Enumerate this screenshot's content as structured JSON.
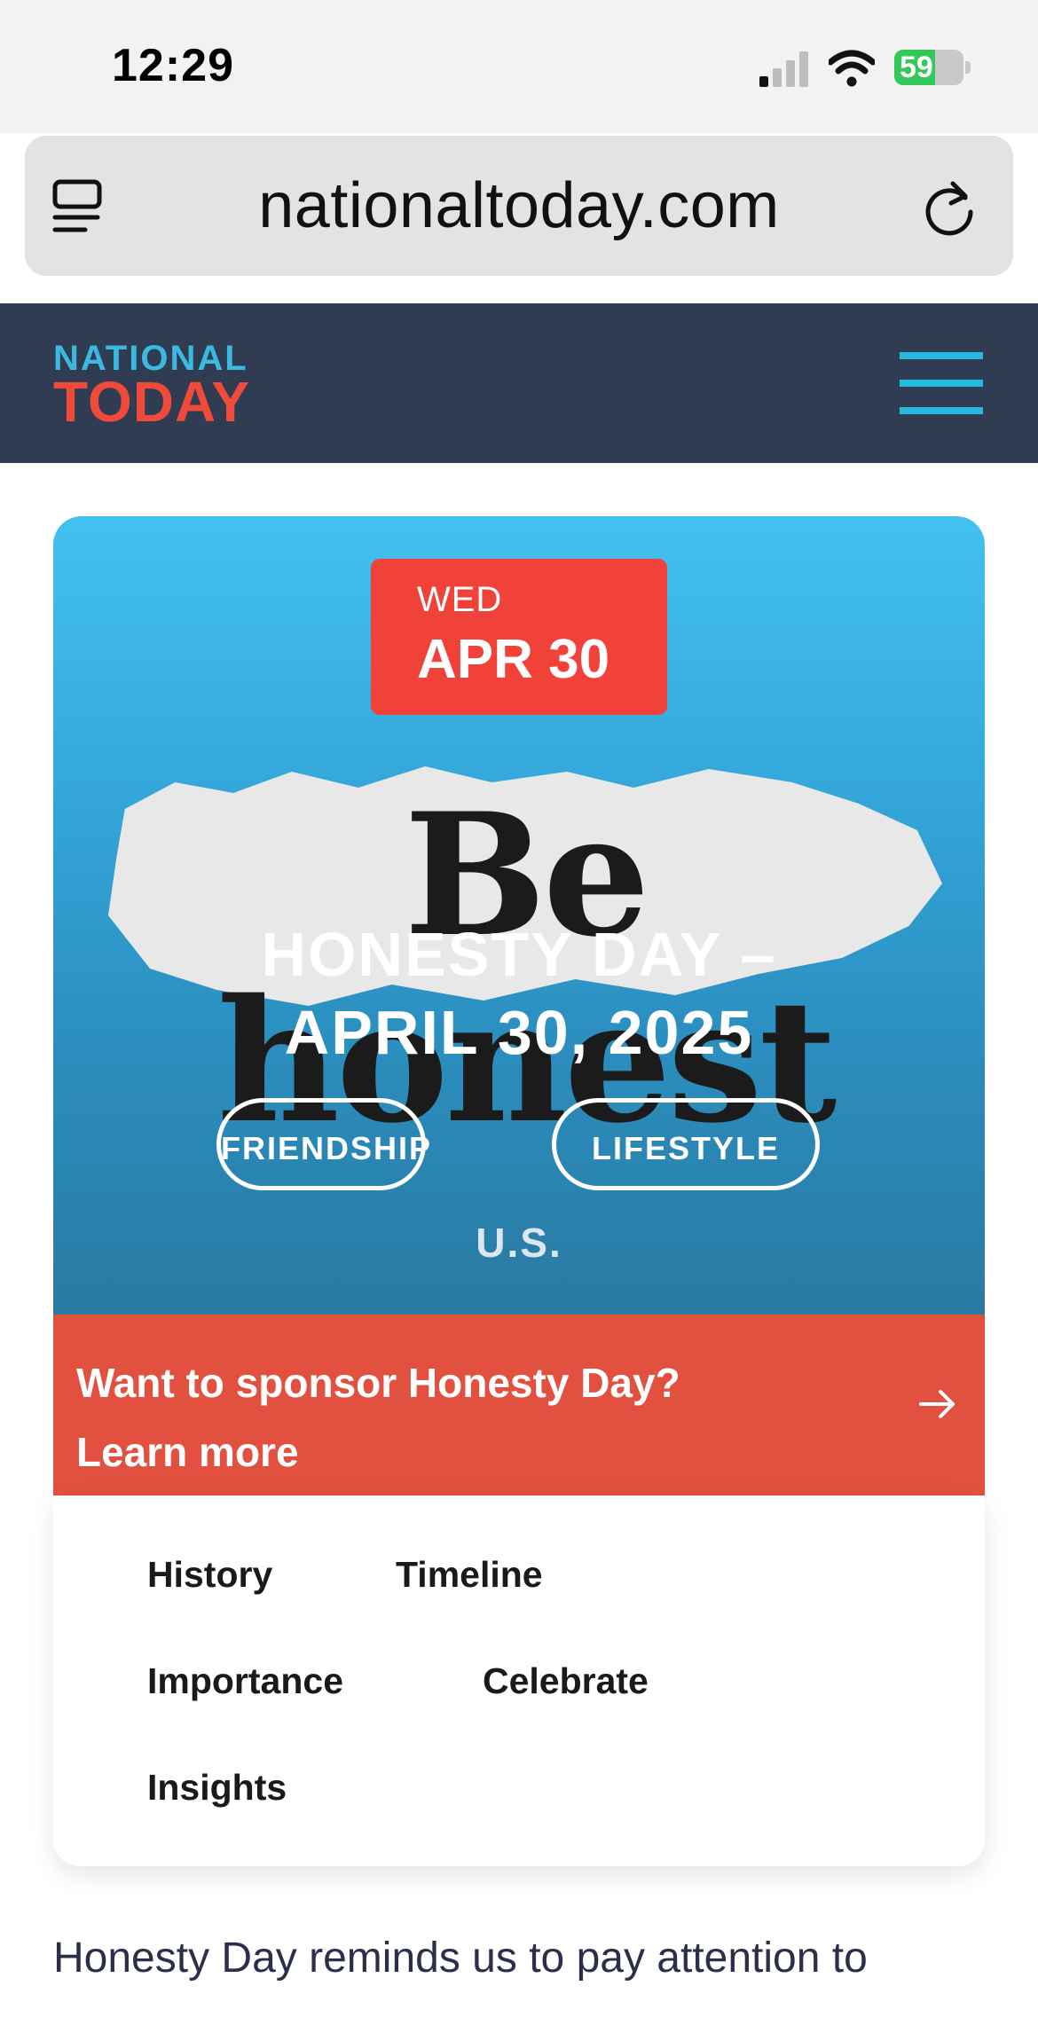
{
  "status_bar": {
    "time": "12:29",
    "battery_percent": "59",
    "battery_level": 0.59,
    "charging": true
  },
  "browser": {
    "url": "nationaltoday.com"
  },
  "site_header": {
    "logo_national": "NATIONAL",
    "logo_today": "TODAY",
    "brand_colors": {
      "header_bg": "#2f3c52",
      "national": "#3cb9e0",
      "today": "#f04a3a",
      "menu": "#26b9dd"
    }
  },
  "hero": {
    "day_of_week": "WED",
    "month_day": "APR 30",
    "image_text": "Be honest",
    "title_line1": "HONESTY DAY –",
    "title_line2": "APRIL 30, 2025",
    "tags": [
      "FRIENDSHIP",
      "LIFESTYLE"
    ],
    "region": "U.S."
  },
  "sponsor": {
    "line1": "Want to sponsor Honesty Day?",
    "line2": "Learn more",
    "color": "#e25140"
  },
  "toc": {
    "links": [
      "History",
      "Timeline",
      "Importance",
      "Celebrate",
      "Insights"
    ]
  },
  "intro": {
    "text": "Honesty Day reminds us to pay attention to"
  }
}
